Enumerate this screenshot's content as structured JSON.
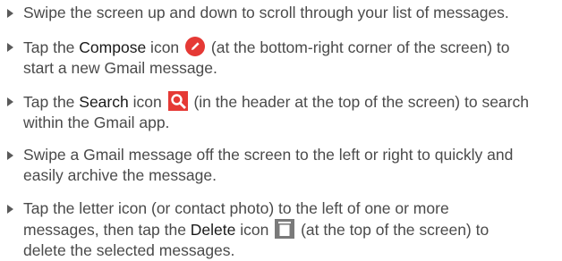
{
  "items": [
    {
      "text": "Swipe the screen up and down to scroll through your list of messages."
    },
    {
      "pre": "Tap the ",
      "term": "Compose",
      "mid": " icon",
      "post_l1": " (at the bottom-right corner of the screen) to",
      "post_l2": "start a new Gmail message.",
      "icon": "compose-icon",
      "icon_color": "#e53935"
    },
    {
      "pre": "Tap the ",
      "term": "Search",
      "mid": " icon",
      "post_l1": " (in the header at the top of the screen) to search",
      "post_l2": "within the Gmail app.",
      "icon": "search-icon",
      "icon_color": "#e53935"
    },
    {
      "l1": "Swipe a Gmail message off the screen to the left or right to quickly and",
      "l2": "easily archive the message."
    },
    {
      "l1": "Tap the letter icon (or contact photo) to the left of one or more",
      "l2_pre": "messages, then tap the ",
      "l2_term": "Delete",
      "l2_mid": " icon",
      "l2_post": " (at the top of the screen) to",
      "l3": "delete the selected messages.",
      "icon": "trash-icon",
      "icon_color": "#7a7a7a"
    }
  ]
}
